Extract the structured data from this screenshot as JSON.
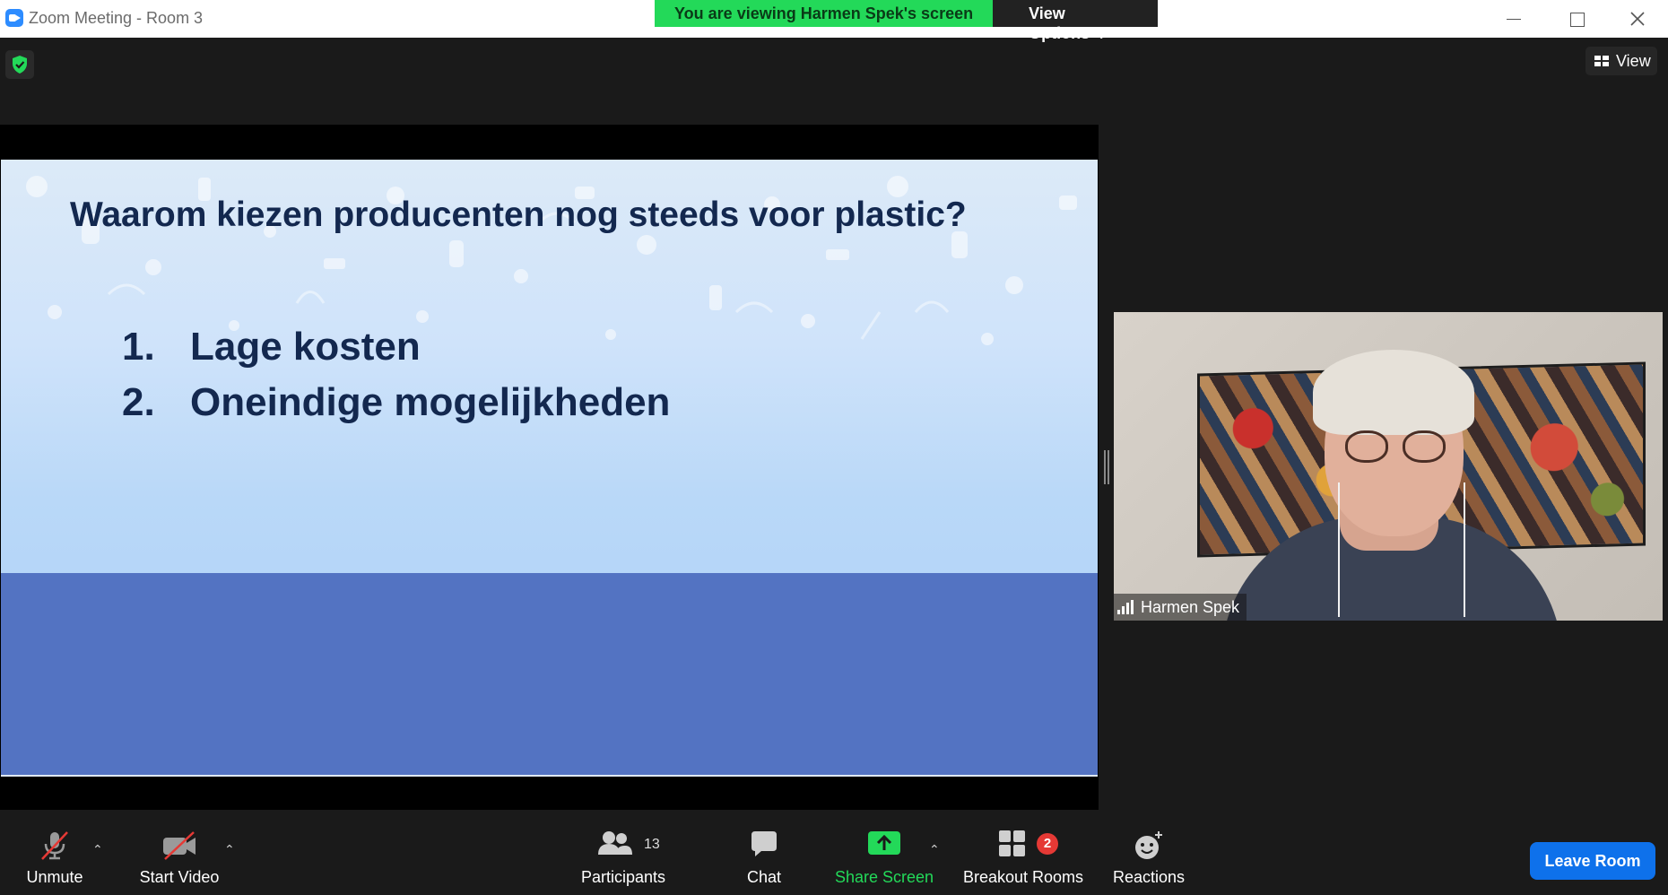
{
  "window": {
    "title": "Zoom Meeting - Room 3",
    "controls": [
      "minimize",
      "maximize",
      "close"
    ]
  },
  "banner": {
    "viewing": "You are viewing Harmen Spek's screen",
    "view_options": "View Options",
    "view_options_icon": "chevron-down-icon"
  },
  "top_right": {
    "view_label": "View"
  },
  "slide": {
    "title": "Waarom kiezen producenten nog steeds voor plastic?",
    "items": [
      {
        "num": "1.",
        "text": "Lage kosten"
      },
      {
        "num": "2.",
        "text": "Oneindige mogelijkheden"
      }
    ],
    "band_color": "#5373c2",
    "title_color": "#13284f"
  },
  "participant_tile": {
    "name": "Harmen Spek"
  },
  "toolbar": {
    "unmute": "Unmute",
    "start_video": "Start Video",
    "participants": "Participants",
    "participants_count": "13",
    "chat": "Chat",
    "share_screen": "Share Screen",
    "breakout_rooms": "Breakout Rooms",
    "breakout_badge": "2",
    "reactions": "Reactions",
    "leave": "Leave Room"
  },
  "colors": {
    "accent_green": "#23d959",
    "leave_blue": "#0e71eb",
    "muted_red": "#e53935"
  }
}
